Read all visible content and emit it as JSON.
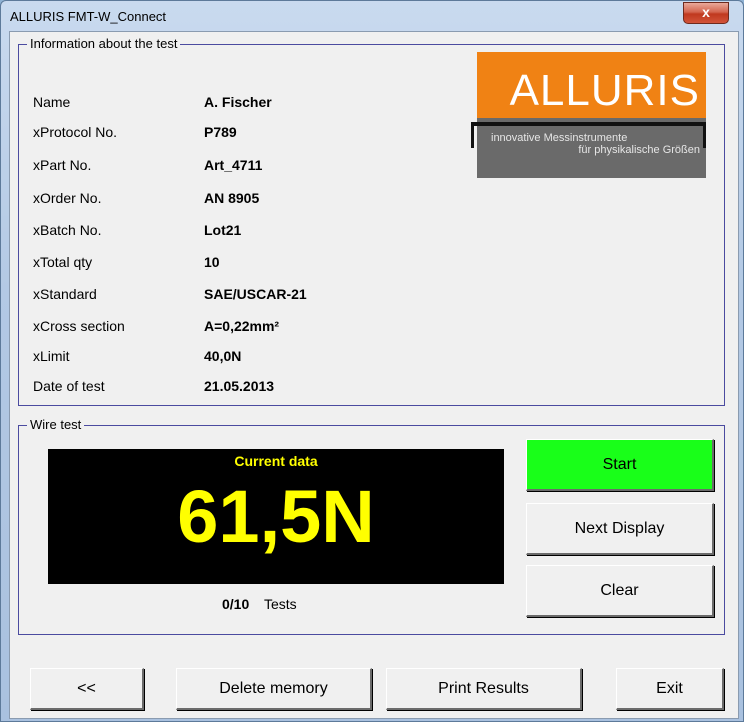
{
  "window": {
    "title": "ALLURIS FMT-W_Connect",
    "close_glyph": "x"
  },
  "info": {
    "legend": "Information about the test",
    "rows": [
      {
        "label": "Name",
        "value": "A. Fischer"
      },
      {
        "label": "xProtocol No.",
        "value": "P789"
      },
      {
        "label": "xPart No.",
        "value": "Art_4711"
      },
      {
        "label": "xOrder No.",
        "value": "AN 8905"
      },
      {
        "label": "xBatch No.",
        "value": "Lot21"
      },
      {
        "label": "xTotal qty",
        "value": "10"
      },
      {
        "label": "xStandard",
        "value": "SAE/USCAR-21"
      },
      {
        "label": "xCross section",
        "value": "A=0,22mm²"
      },
      {
        "label": "xLimit",
        "value": "40,0N"
      },
      {
        "label": "Date of test",
        "value": "21.05.2013"
      }
    ]
  },
  "logo": {
    "brand": "ALLURIS",
    "tagline_1": "innovative Messinstrumente",
    "tagline_2": "für physikalische Größen"
  },
  "wire_test": {
    "legend": "Wire test",
    "display_label": "Current data",
    "display_value": "61,5N",
    "tests_count": "0/10",
    "tests_label": "Tests",
    "start_label": "Start",
    "next_display_label": "Next Display",
    "clear_label": "Clear"
  },
  "footer": {
    "back_label": "<<",
    "delete_label": "Delete memory",
    "print_label": "Print Results",
    "exit_label": "Exit"
  },
  "colors": {
    "start_button": "#19ff19",
    "display_text": "#ffff00",
    "display_background": "#000000",
    "logo_orange": "#f08214",
    "group_border": "#4b4ba0"
  }
}
